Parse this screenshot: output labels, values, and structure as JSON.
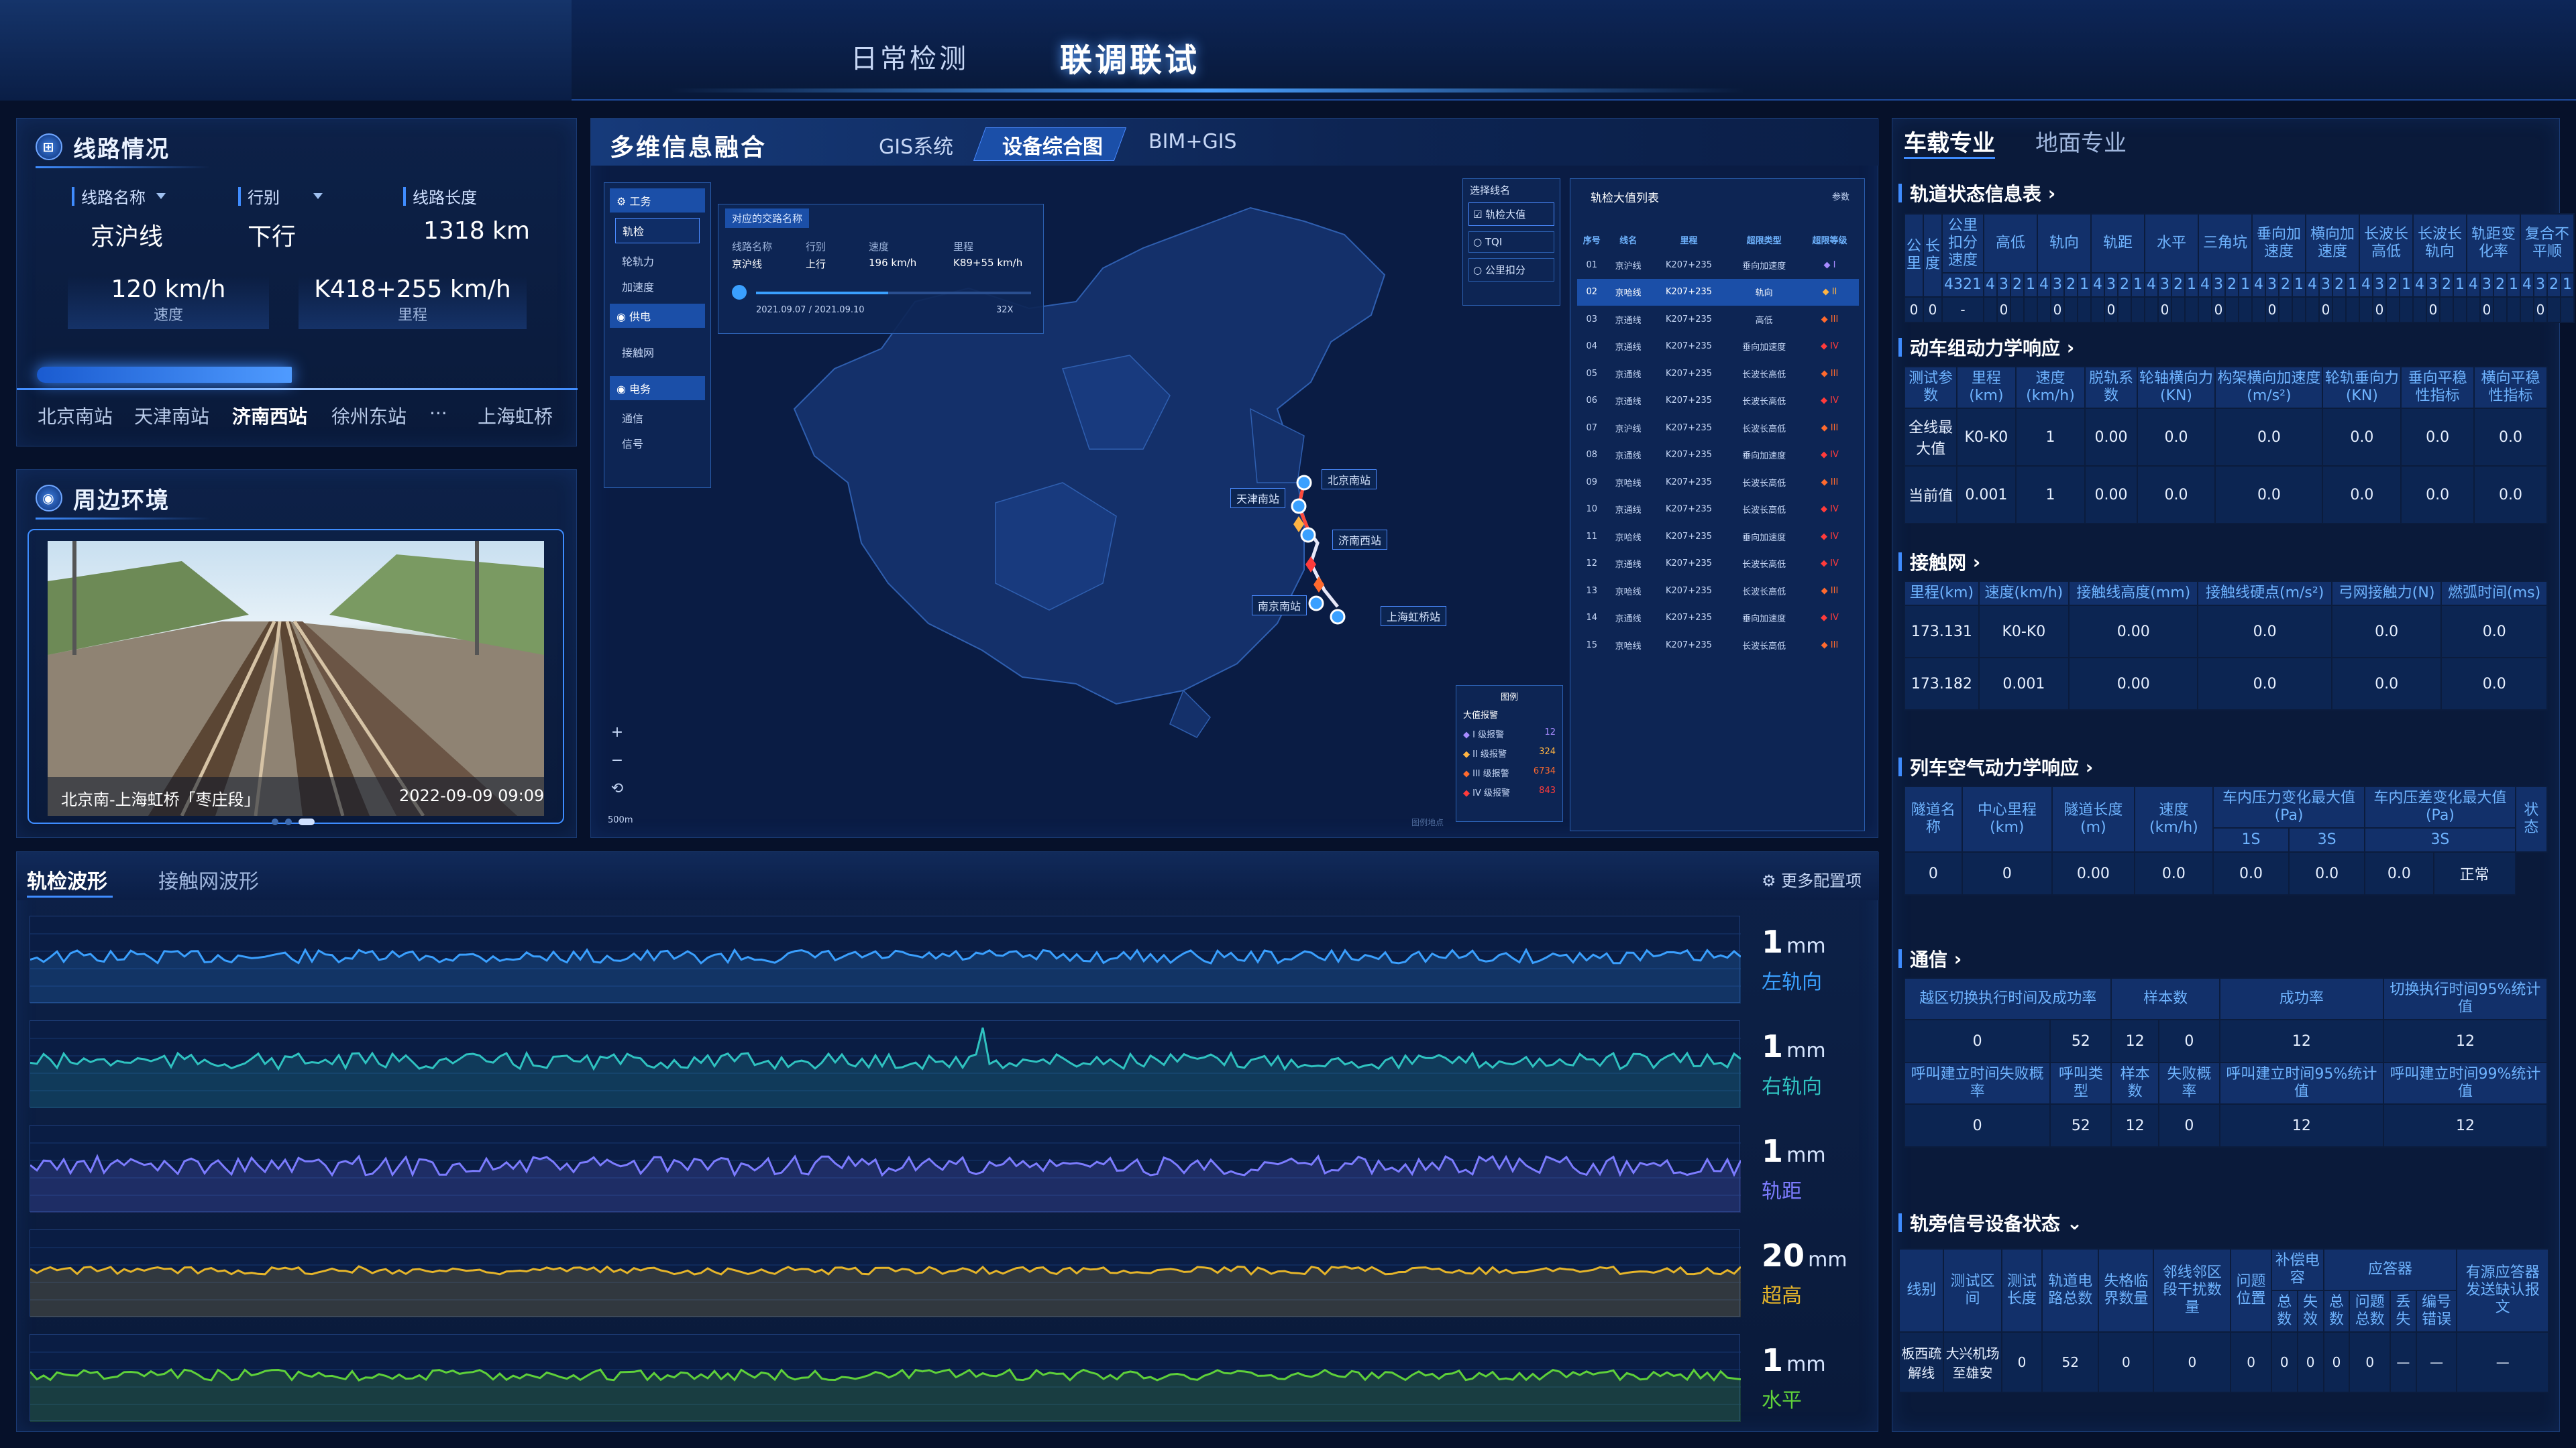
{
  "nav": {
    "tabs": [
      "日常检测",
      "联调联试"
    ],
    "active": "联调联试"
  },
  "line_panel": {
    "title": "线路情况",
    "fields": [
      {
        "label": "线路名称",
        "value": "京沪线",
        "dropdown": true
      },
      {
        "label": "行别",
        "value": "下行",
        "dropdown": true
      },
      {
        "label": "线路长度",
        "value": "1318 km",
        "dropdown": false
      }
    ],
    "speed": {
      "value": "120 km/h",
      "label": "速度"
    },
    "mileage": {
      "value": "K418+255 km/h",
      "label": "里程"
    },
    "stations": [
      "北京南站",
      "天津南站",
      "济南西站",
      "徐州东站",
      "···",
      "上海虹桥"
    ],
    "active_station": "济南西站"
  },
  "env_panel": {
    "title": "周边环境",
    "caption": "北京南-上海虹桥「枣庄段」",
    "timestamp": "2022-09-09  09:09"
  },
  "map_panel": {
    "title": "多维信息融合",
    "tabs": [
      "GIS系统",
      "设备综合图",
      "BIM+GIS"
    ],
    "active_tab": "设备综合图",
    "layer_menu": {
      "groups": [
        {
          "name": "工务",
          "items": [
            "轨检",
            "轮轨力",
            "加速度"
          ]
        },
        {
          "name": "供电",
          "items": [
            "接触网"
          ]
        },
        {
          "name": "电务",
          "items": [
            "通信",
            "信号"
          ]
        }
      ],
      "selected": "轨检"
    },
    "traffic": {
      "title": "对应的交路名称",
      "cols": [
        "线路名称",
        "行别",
        "速度",
        "里程"
      ],
      "vals": [
        "京沪线",
        "上行",
        "196 km/h",
        "K89+55 km/h"
      ],
      "range": "2021.09.07 / 2021.09.10",
      "speed_mult": "32X"
    },
    "select_line": {
      "title": "选择线名",
      "options": [
        "轨检大值",
        "TQI",
        "公里扣分"
      ],
      "checked": "轨检大值"
    },
    "big_list": {
      "title": "轨检大值列表",
      "settings": "参数",
      "headers": [
        "序号",
        "线名",
        "里程",
        "超限类型",
        "超限等级"
      ],
      "rows": [
        [
          "01",
          "京沪线",
          "K207+235",
          "垂向加速度",
          "I"
        ],
        [
          "02",
          "京哈线",
          "K207+235",
          "轨向",
          "II"
        ],
        [
          "03",
          "京通线",
          "K207+235",
          "高低",
          "III"
        ],
        [
          "04",
          "京通线",
          "K207+235",
          "垂向加速度",
          "IV"
        ],
        [
          "05",
          "京通线",
          "K207+235",
          "长波长高低",
          "III"
        ],
        [
          "06",
          "京通线",
          "K207+235",
          "长波长高低",
          "IV"
        ],
        [
          "07",
          "京沪线",
          "K207+235",
          "长波长高低",
          "III"
        ],
        [
          "08",
          "京通线",
          "K207+235",
          "垂向加速度",
          "IV"
        ],
        [
          "09",
          "京哈线",
          "K207+235",
          "长波长高低",
          "III"
        ],
        [
          "10",
          "京通线",
          "K207+235",
          "长波长高低",
          "IV"
        ],
        [
          "11",
          "京哈线",
          "K207+235",
          "垂向加速度",
          "IV"
        ],
        [
          "12",
          "京通线",
          "K207+235",
          "长波长高低",
          "IV"
        ],
        [
          "13",
          "京哈线",
          "K207+235",
          "长波长高低",
          "III"
        ],
        [
          "14",
          "京通线",
          "K207+235",
          "垂向加速度",
          "IV"
        ],
        [
          "15",
          "京哈线",
          "K207+235",
          "长波长高低",
          "III"
        ]
      ],
      "selected_row": "02"
    },
    "legend": {
      "title": "图例",
      "subtitle": "大值报警",
      "items": [
        {
          "name": "I 级报警",
          "count": "12",
          "color": "#a78bff"
        },
        {
          "name": "II 级报警",
          "count": "324",
          "color": "#ffb443"
        },
        {
          "name": "III 级报警",
          "count": "6734",
          "color": "#ff6a2e"
        },
        {
          "name": "IV 级报警",
          "count": "843",
          "color": "#ff3b3b"
        }
      ]
    },
    "map_labels": [
      "北京南站",
      "天津南站",
      "济南西站",
      "南京南站",
      "上海虹桥站"
    ],
    "scale": "500m",
    "watermark": "图例地点"
  },
  "wave_panel": {
    "tabs": [
      "轨检波形",
      "接触网波形"
    ],
    "active": "轨检波形",
    "more": "更多配置项",
    "channels": [
      {
        "value": "1",
        "unit": "mm",
        "name": "左轨向",
        "color": "#3aa0ff"
      },
      {
        "value": "1",
        "unit": "mm",
        "name": "右轨向",
        "color": "#2fc2c0"
      },
      {
        "value": "1",
        "unit": "mm",
        "name": "轨距",
        "color": "#7c7cff"
      },
      {
        "value": "20",
        "unit": "mm",
        "name": "超高",
        "color": "#e6b52a"
      },
      {
        "value": "1",
        "unit": "mm",
        "name": "水平",
        "color": "#5fd13a"
      }
    ]
  },
  "right": {
    "tabs": [
      "车载专业",
      "地面专业"
    ],
    "active": "车载专业",
    "track": {
      "title": "轨道状态信息表",
      "headers": [
        "公里",
        "长度",
        "公里扣分速度",
        "高低",
        "轨向",
        "轨距",
        "水平",
        "三角坑",
        "垂向加速度",
        "横向加速度",
        "长波长高低",
        "长波长轨向",
        "轨距变化率",
        "复合不平顺"
      ],
      "sub": "4321",
      "row": [
        "0",
        "0",
        "-",
        "-",
        "0",
        "0",
        "0",
        "0",
        "0",
        "0",
        "0",
        "0",
        "0",
        "0",
        "0",
        "0"
      ]
    },
    "emu": {
      "title": "动车组动力学响应",
      "headers": [
        "测试参数",
        "里程(km)",
        "速度(km/h)",
        "脱轨系数",
        "轮轴横向力(KN)",
        "构架横向加速度(m/s²)",
        "轮轨垂向力(KN)",
        "垂向平稳性指标",
        "横向平稳性指标"
      ],
      "rows": [
        [
          "全线最大值",
          "K0-K0",
          "1",
          "0.00",
          "0.0",
          "0.0",
          "0.0",
          "0.0",
          "0.0"
        ],
        [
          "当前值",
          "0.001",
          "1",
          "0.00",
          "0.0",
          "0.0",
          "0.0",
          "0.0",
          "0.0"
        ]
      ]
    },
    "catenary": {
      "title": "接触网",
      "headers": [
        "里程(km)",
        "速度(km/h)",
        "接触线高度(mm)",
        "接触线硬点(m/s²)",
        "弓网接触力(N)",
        "燃弧时间(ms)"
      ],
      "rows": [
        [
          "173.131",
          "K0-K0",
          "0.00",
          "0.0",
          "0.0",
          "0.0"
        ],
        [
          "173.182",
          "0.001",
          "0.00",
          "0.0",
          "0.0",
          "0.0"
        ]
      ]
    },
    "aero": {
      "title": "列车空气动力学响应",
      "headers": [
        "隧道名称",
        "中心里程(km)",
        "隧道长度(m)",
        "速度(km/h)",
        "车内压力变化最大值(Pa)",
        "车内压差变化最大值(Pa)",
        "状态"
      ],
      "sub": [
        "1S",
        "3S",
        "3S"
      ],
      "row": [
        "0",
        "0",
        "0.00",
        "0.0",
        "0.0",
        "0.0",
        "0.0",
        "正常"
      ]
    },
    "comm": {
      "title": "通信",
      "headers1": [
        "越区切换执行时间及成功率",
        "样本数",
        "成功率",
        "切换执行时间95%统计值"
      ],
      "row1": [
        "0",
        "52",
        "12",
        "0",
        "12",
        "12"
      ],
      "headers2": [
        "呼叫建立时间失败概率",
        "呼叫类型",
        "样本数",
        "失败概率",
        "呼叫建立时间95%统计值",
        "呼叫建立时间99%统计值"
      ],
      "row2": [
        "0",
        "52",
        "12",
        "0",
        "12",
        "12"
      ]
    },
    "signal": {
      "title": "轨旁信号设备状态",
      "headers": [
        "线别",
        "测试区间",
        "测试长度",
        "轨道电路总数",
        "失格临界数量",
        "邻线邻区段干扰数量",
        "问题位置",
        "补偿电容",
        "应答器",
        "有源应答器发送缺认报文"
      ],
      "cap_sub": [
        "总数",
        "失效"
      ],
      "bal_sub": [
        "总数",
        "问题总数",
        "丢失",
        "编号错误"
      ],
      "row": [
        "板西疏解线",
        "大兴机场至雄安",
        "0",
        "52",
        "0",
        "0",
        "0",
        "0",
        "0",
        "0",
        "0",
        "—",
        "—",
        "—"
      ]
    }
  }
}
